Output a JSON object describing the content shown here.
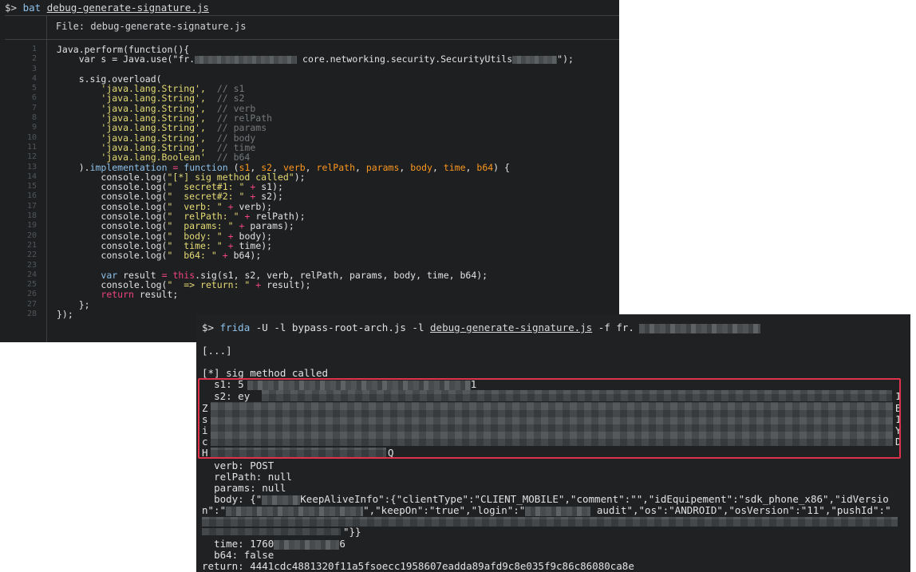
{
  "top_terminal": {
    "command_prompt": "$>",
    "command_bin": "bat",
    "command_file": "debug-generate-signature.js",
    "file_header": "File: debug-generate-signature.js",
    "line_numbers": [
      "1",
      "2",
      "3",
      "4",
      "5",
      "6",
      "7",
      "8",
      "9",
      "10",
      "11",
      "12",
      "13",
      "14",
      "15",
      "16",
      "17",
      "18",
      "19",
      "20",
      "21",
      "22",
      "23",
      "24",
      "25",
      "26",
      "27",
      "28"
    ],
    "code": {
      "l1": "Java.perform(function(){",
      "l2_a": "var s = Java.use(\"fr.",
      "l2_b": "core.networking.security.SecurityUtils",
      "l2_c": "\");",
      "l4": "s.sig.overload(",
      "string_type": "'java.lang.String',",
      "bool_type": "'java.lang.Boolean'",
      "comments": [
        "// s1",
        "// s2",
        "// verb",
        "// relPath",
        "// params",
        "// body",
        "// time",
        "// b64"
      ],
      "l13_a": ").",
      "l13_impl": "implementation",
      "l13_eq": " = ",
      "l13_fn": "function",
      "l13_params": [
        "s1",
        "s2",
        "verb",
        "relPath",
        "params",
        "body",
        "time",
        "b64"
      ],
      "l13_end": ") {",
      "log_called": "\"[*] sig method called\"",
      "log_lines": [
        {
          "str": "\"  secret#1: \"",
          "var": "s1"
        },
        {
          "str": "\"  secret#2: \"",
          "var": "s2"
        },
        {
          "str": "\"  verb: \"",
          "var": "verb"
        },
        {
          "str": "\"  relPath: \"",
          "var": "relPath"
        },
        {
          "str": "\"  params: \"",
          "var": "params"
        },
        {
          "str": "\"  body: \"",
          "var": "body"
        },
        {
          "str": "\"  time: \"",
          "var": "time"
        },
        {
          "str": "\"  b64: \"",
          "var": "b64"
        }
      ],
      "console_log": "console.log(",
      "l24_var": "var",
      "l24_a": " result ",
      "l24_eq": "=",
      "l24_this": "this",
      "l24_b": ".sig(s1, s2, verb, relPath, params, body, time, b64);",
      "l25_str": "\"  => return: \"",
      "l25_var": "result",
      "l26_ret": "return",
      "l26_b": " result;",
      "l27": "};",
      "l28": "});"
    }
  },
  "bottom_terminal": {
    "prompt": "$>",
    "cmd_bin": "frida",
    "cmd_args": "-U -l bypass-root-arch.js -l",
    "cmd_file": "debug-generate-signature.js",
    "cmd_tail": "-f fr.",
    "ellipsis": "[...]",
    "called": "[*] sig method called",
    "s1_label": "s1: 5",
    "s1_end": "1",
    "s2_label": "s2: ey",
    "s2_end": "1",
    "wrap_left": [
      "Z",
      "s",
      "i",
      "c",
      "H"
    ],
    "wrap_right": [
      "B",
      "1",
      "Y",
      "D"
    ],
    "wrap_last_end": "Q",
    "verb": "verb: POST",
    "relPath": "relPath: null",
    "params": "params: null",
    "body_a": "body: {\"",
    "body_b": "KeepAliveInfo\":{\"clientType\":\"CLIENT_MOBILE\",\"comment\":\"\",\"idEquipement\":\"sdk_phone_x86\",\"idVersio",
    "body_c": "n\":\"",
    "body_d": "\",\"keepOn\":\"true\",\"login\":\"",
    "body_e": "audit\",\"os\":\"ANDROID\",\"osVersion\":\"11\",\"pushId\":\"",
    "body_f": "\"}}",
    "time_a": "time: 1760",
    "time_b": "6",
    "b64": "b64: false",
    "return": "return: 4441cdc4881320f11a5fsoecc1958607eadda89afd9c8e035f9c86c86080ca8e"
  },
  "colors": {
    "highlight": "#e0324a",
    "keyword": "#f0447a",
    "string": "#e6db74",
    "param": "#fd971f",
    "function": "#8fc1e9"
  }
}
